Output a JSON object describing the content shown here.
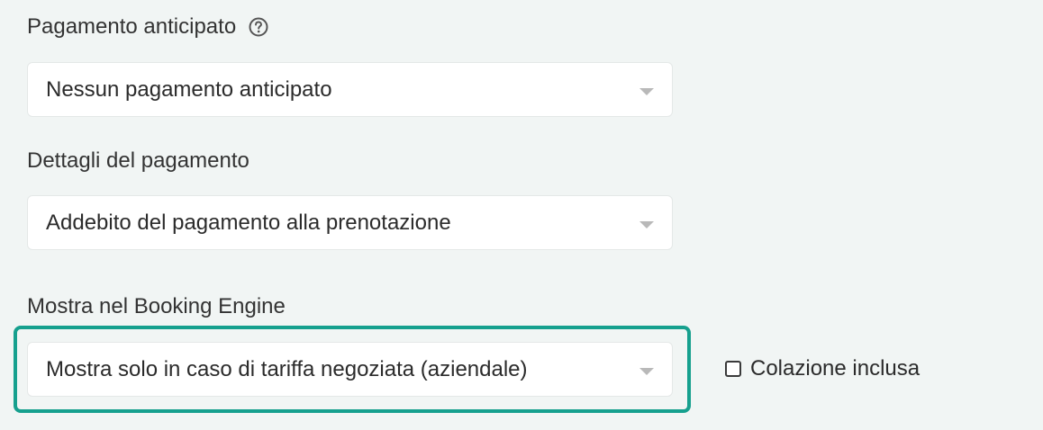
{
  "payment_advance": {
    "label": "Pagamento anticipato",
    "help_icon": "question-circle-icon",
    "selected": "Nessun pagamento anticipato"
  },
  "payment_details": {
    "label": "Dettagli del pagamento",
    "selected": "Addebito del pagamento alla prenotazione"
  },
  "booking_engine": {
    "label": "Mostra nel Booking Engine",
    "selected": "Mostra solo in caso di tariffa negoziata (aziendale)",
    "highlight_color": "#16a08e"
  },
  "breakfast": {
    "label": "Colazione inclusa",
    "checked": false
  }
}
